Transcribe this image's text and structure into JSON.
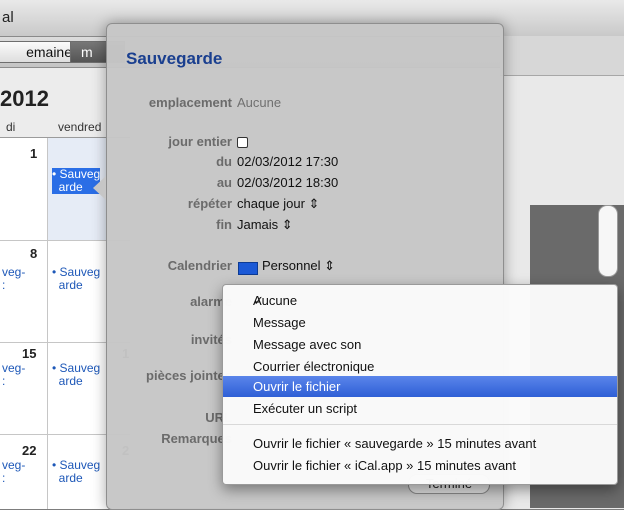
{
  "window": {
    "title_fragment": "al"
  },
  "view_tabs": {
    "week": "emaine",
    "month": "m"
  },
  "calendar": {
    "year": "2012",
    "day_headers": [
      "di",
      "vendred"
    ],
    "week_numbers": [
      "1",
      "8",
      "15",
      "22"
    ],
    "friday_numbers": [
      "",
      "",
      "1",
      "2"
    ],
    "events": [
      {
        "text": "• Sauveg\n  arde",
        "selected": true
      },
      {
        "text": "• Sauveg\n  arde",
        "selected": false
      },
      {
        "text": "• Sauveg\n  arde",
        "selected": false
      },
      {
        "text": "• Sauveg\n  arde",
        "selected": false
      }
    ],
    "left_fragments": [
      "veg-\n:",
      "veg-\n:",
      "veg-\n:"
    ]
  },
  "popover": {
    "title": "Sauvegarde",
    "labels": {
      "location": "emplacement",
      "all_day": "jour entier",
      "from": "du",
      "to": "au",
      "repeat": "répéter",
      "end": "fin",
      "calendar": "Calendrier",
      "alarm": "alarme",
      "invitees": "invités",
      "attachments": "pièces jointes",
      "url": "URL",
      "notes": "Remarques"
    },
    "values": {
      "location": "Aucune",
      "from": "02/03/2012 17:30",
      "to": "02/03/2012 18:30",
      "repeat": "chaque jour ⇕",
      "end": "Jamais ⇕",
      "calendar": "Personnel ⇕"
    },
    "done_button": "Terminé"
  },
  "alarm_menu": {
    "check_glyph": "✓",
    "items": [
      {
        "label": "Aucune",
        "checked": true
      },
      {
        "label": "Message"
      },
      {
        "label": "Message avec son"
      },
      {
        "label": "Courrier électronique"
      },
      {
        "label": "Ouvrir le fichier",
        "highlighted": true
      },
      {
        "label": "Exécuter un script"
      },
      {
        "label": "Ouvrir le fichier « sauvegarde » 15 minutes avant"
      },
      {
        "label": "Ouvrir le fichier « iCal.app » 15 minutes avant"
      }
    ]
  },
  "colors": {
    "accent": "#2f5fd6",
    "calendar_personal": "#1b59d6",
    "title": "#1a3f8f"
  }
}
